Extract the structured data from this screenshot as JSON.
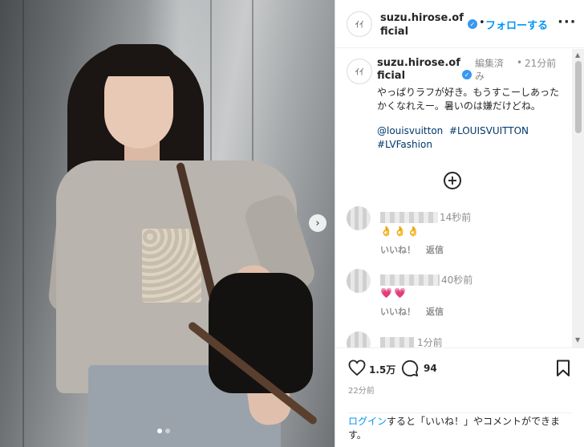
{
  "post": {
    "username": "suzu.hirose.official",
    "follow_label": "フォローする",
    "dot": "•",
    "more": "···"
  },
  "caption": {
    "username": "suzu.hirose.official",
    "edited": "編集済み",
    "dot": "•",
    "time": "21分前",
    "text": "やっぱりラフが好き。もうすこーしあったかくなれえー。暑いのは嫌だけどね。",
    "tags": [
      "@louisvuitton",
      "#LOUISVUITTON",
      "#LVFashion"
    ]
  },
  "comments": [
    {
      "time": "14秒前",
      "emoji": "👌👌👌",
      "like": "いいね！",
      "reply": "返信"
    },
    {
      "time": "40秒前",
      "emoji": "💗💗",
      "like": "いいね！",
      "reply": "返信"
    },
    {
      "time": "1分前"
    }
  ],
  "actions": {
    "likes": "1.5万",
    "comments": "94",
    "posted_ago": "22分前"
  },
  "login": {
    "link": "ログイン",
    "rest": "すると「いいね！」やコメントができます。"
  },
  "colors": {
    "follow": "#0095f6",
    "tag": "#00376b",
    "verified": "#3897f0"
  }
}
